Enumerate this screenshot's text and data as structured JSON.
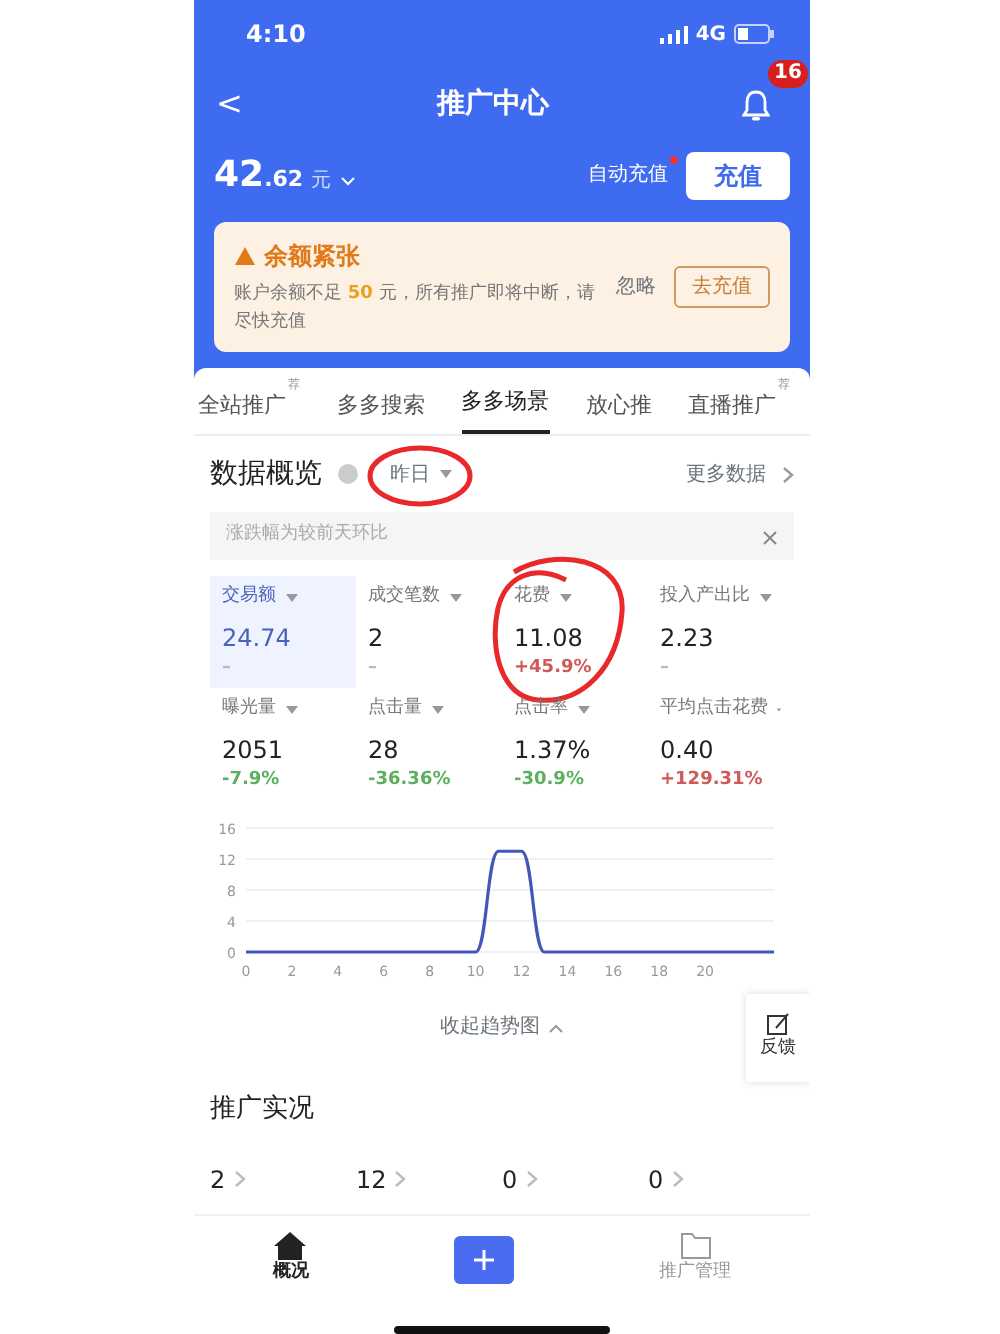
{
  "status_bar": {
    "time": "4:10",
    "network": "4G"
  },
  "header": {
    "title": "推广中心",
    "back": "<",
    "bell_badge": "16"
  },
  "balance": {
    "integer": "42",
    "decimal": ".62",
    "unit": "元",
    "auto_recharge": "自动充值",
    "auto_recharge_dot": true,
    "recharge_button": "充值"
  },
  "alert": {
    "title": "余额紧张",
    "text_before": "账户余额不足 ",
    "amount": "50",
    "text_after": " 元，所有推广即将中断，请尽快充值",
    "ignore": "忽略",
    "action": "去充值"
  },
  "tabs": [
    {
      "label": "全站推广",
      "tag": "荐",
      "selected": false
    },
    {
      "label": "多多搜索",
      "selected": false
    },
    {
      "label": "多多场景",
      "selected": true
    },
    {
      "label": "放心推",
      "selected": false
    },
    {
      "label": "直播推广",
      "tag": "荐",
      "selected": false
    }
  ],
  "overview": {
    "title": "数据概览",
    "date": "昨日",
    "date_circled": true,
    "more": "更多数据",
    "hint": "涨跌幅为较前天环比"
  },
  "metrics": [
    {
      "label": "交易额",
      "value": "24.74",
      "change": "–",
      "color": "#bbbbbb",
      "selected": true,
      "circled": false
    },
    {
      "label": "成交笔数",
      "value": "2",
      "change": "–",
      "color": "#bbbbbb",
      "selected": false,
      "circled": false
    },
    {
      "label": "花费",
      "value": "11.08",
      "change": "+45.9%",
      "color": "#d05a5a",
      "selected": false,
      "circled": true
    },
    {
      "label": "投入产出比",
      "value": "2.23",
      "change": "–",
      "color": "#bbbbbb",
      "selected": false,
      "circled": false
    },
    {
      "label": "曝光量",
      "value": "2051",
      "change": "-7.9%",
      "color": "#5db05d",
      "selected": false,
      "circled": false
    },
    {
      "label": "点击量",
      "value": "28",
      "change": "-36.36%",
      "color": "#5db05d",
      "selected": false,
      "circled": false
    },
    {
      "label": "点击率",
      "value": "1.37%",
      "change": "-30.9%",
      "color": "#5db05d",
      "selected": false,
      "circled": false
    },
    {
      "label": "平均点击花费",
      "value": "0.40",
      "change": "+129.31%",
      "color": "#d05a5a",
      "selected": false,
      "circled": false
    }
  ],
  "chart_data": {
    "type": "line",
    "x": [
      0,
      1,
      2,
      3,
      4,
      5,
      6,
      7,
      8,
      9,
      10,
      11,
      12,
      13,
      14,
      15,
      16,
      17,
      18,
      19,
      20,
      21,
      22,
      23
    ],
    "series": [
      {
        "color": "#4457b8",
        "values": [
          0,
          0,
          0,
          0,
          0,
          0,
          0,
          0,
          0,
          0,
          0,
          13,
          13,
          0,
          0,
          0,
          0,
          0,
          0,
          0,
          0,
          0,
          0,
          0
        ]
      }
    ],
    "xlim": [
      0,
      23
    ],
    "ylim": [
      0,
      16
    ],
    "xticks": [
      0,
      2,
      4,
      6,
      8,
      10,
      12,
      14,
      16,
      18,
      20
    ],
    "yticks": [
      0,
      4,
      8,
      12,
      16
    ],
    "grid": true
  },
  "collapse": "收起趋势图",
  "feedback": "反馈",
  "live": {
    "title": "推广实况",
    "values": [
      "2",
      "12",
      "0",
      "0"
    ]
  },
  "tab_bar": [
    {
      "kind": "tab",
      "label": "概况",
      "selected": true
    },
    {
      "kind": "add"
    },
    {
      "kind": "tab",
      "label": "推广管理",
      "selected": false
    }
  ]
}
